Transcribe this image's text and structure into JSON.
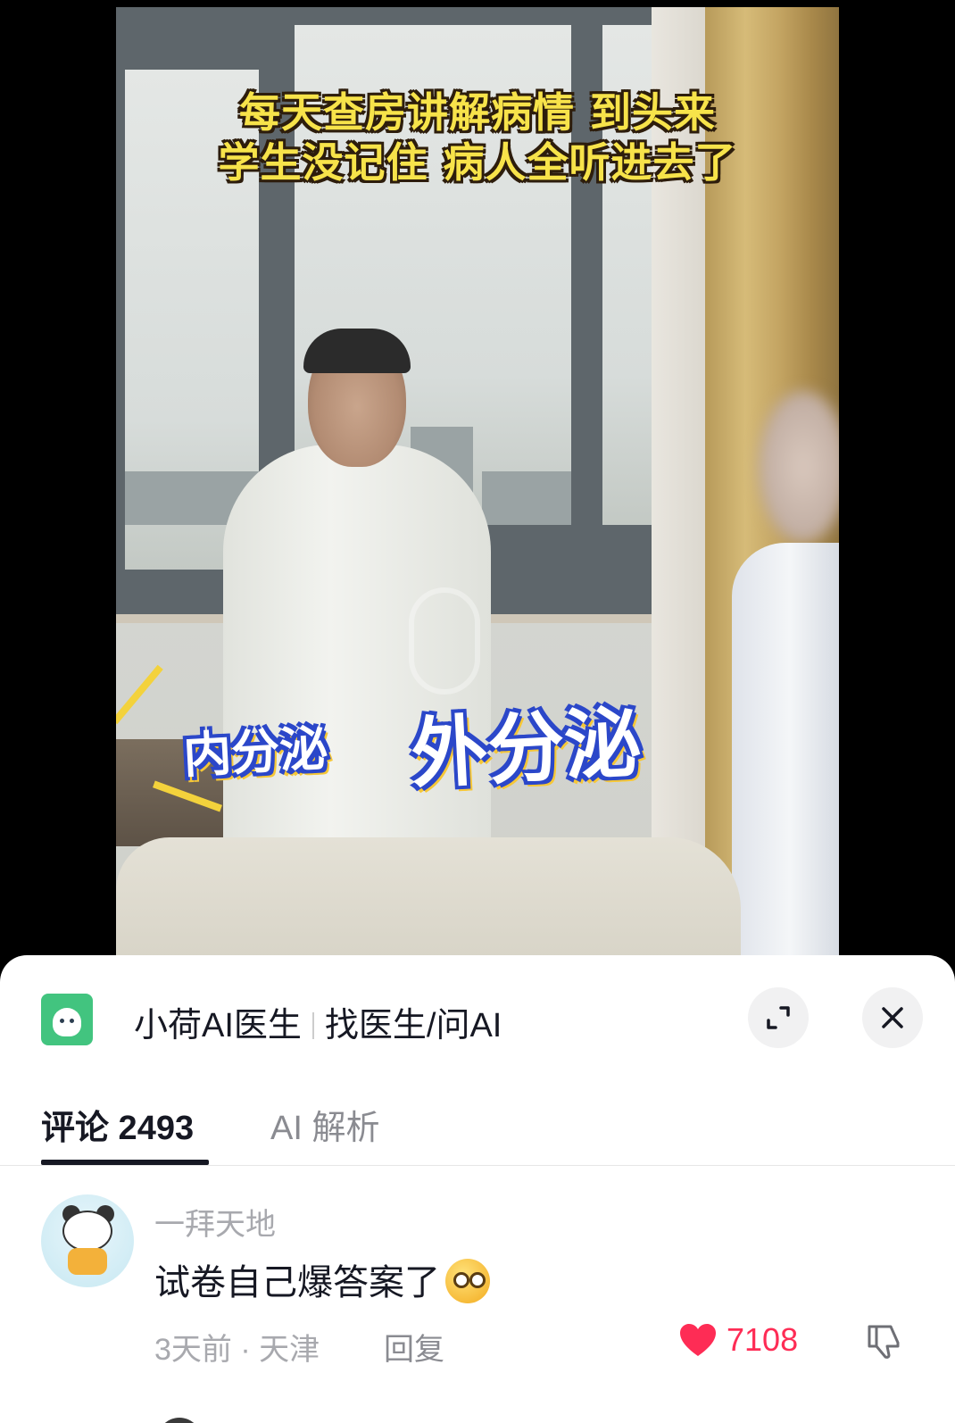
{
  "video": {
    "caption_line1": "每天查房讲解病情 到头来",
    "caption_line2": "学生没记住 病人全听进去了",
    "sticker_small": "内分泌",
    "sticker_large": "外分泌"
  },
  "mini_header": {
    "title": "小荷AI医生",
    "subtitle": "找医生/问AI",
    "logo_icon": "xiaohe-logo-icon",
    "expand_icon": "expand-icon",
    "close_icon": "close-icon"
  },
  "tabs": {
    "comments_label": "评论 2493",
    "ai_label": "AI 解析"
  },
  "comment": {
    "username": "一拜天地",
    "text": "试卷自己爆答案了",
    "emoji": "dizzy-emoji-icon",
    "meta": "3天前 · 天津",
    "reply_label": "回复",
    "likes": "7108"
  },
  "colors": {
    "accent_like": "#fe2c55",
    "text_primary": "#161823",
    "text_secondary": "#a8a9ae",
    "caption_yellow": "#f7e34a",
    "sticker_blue": "#2b47c9",
    "logo_green": "#42c47f"
  }
}
